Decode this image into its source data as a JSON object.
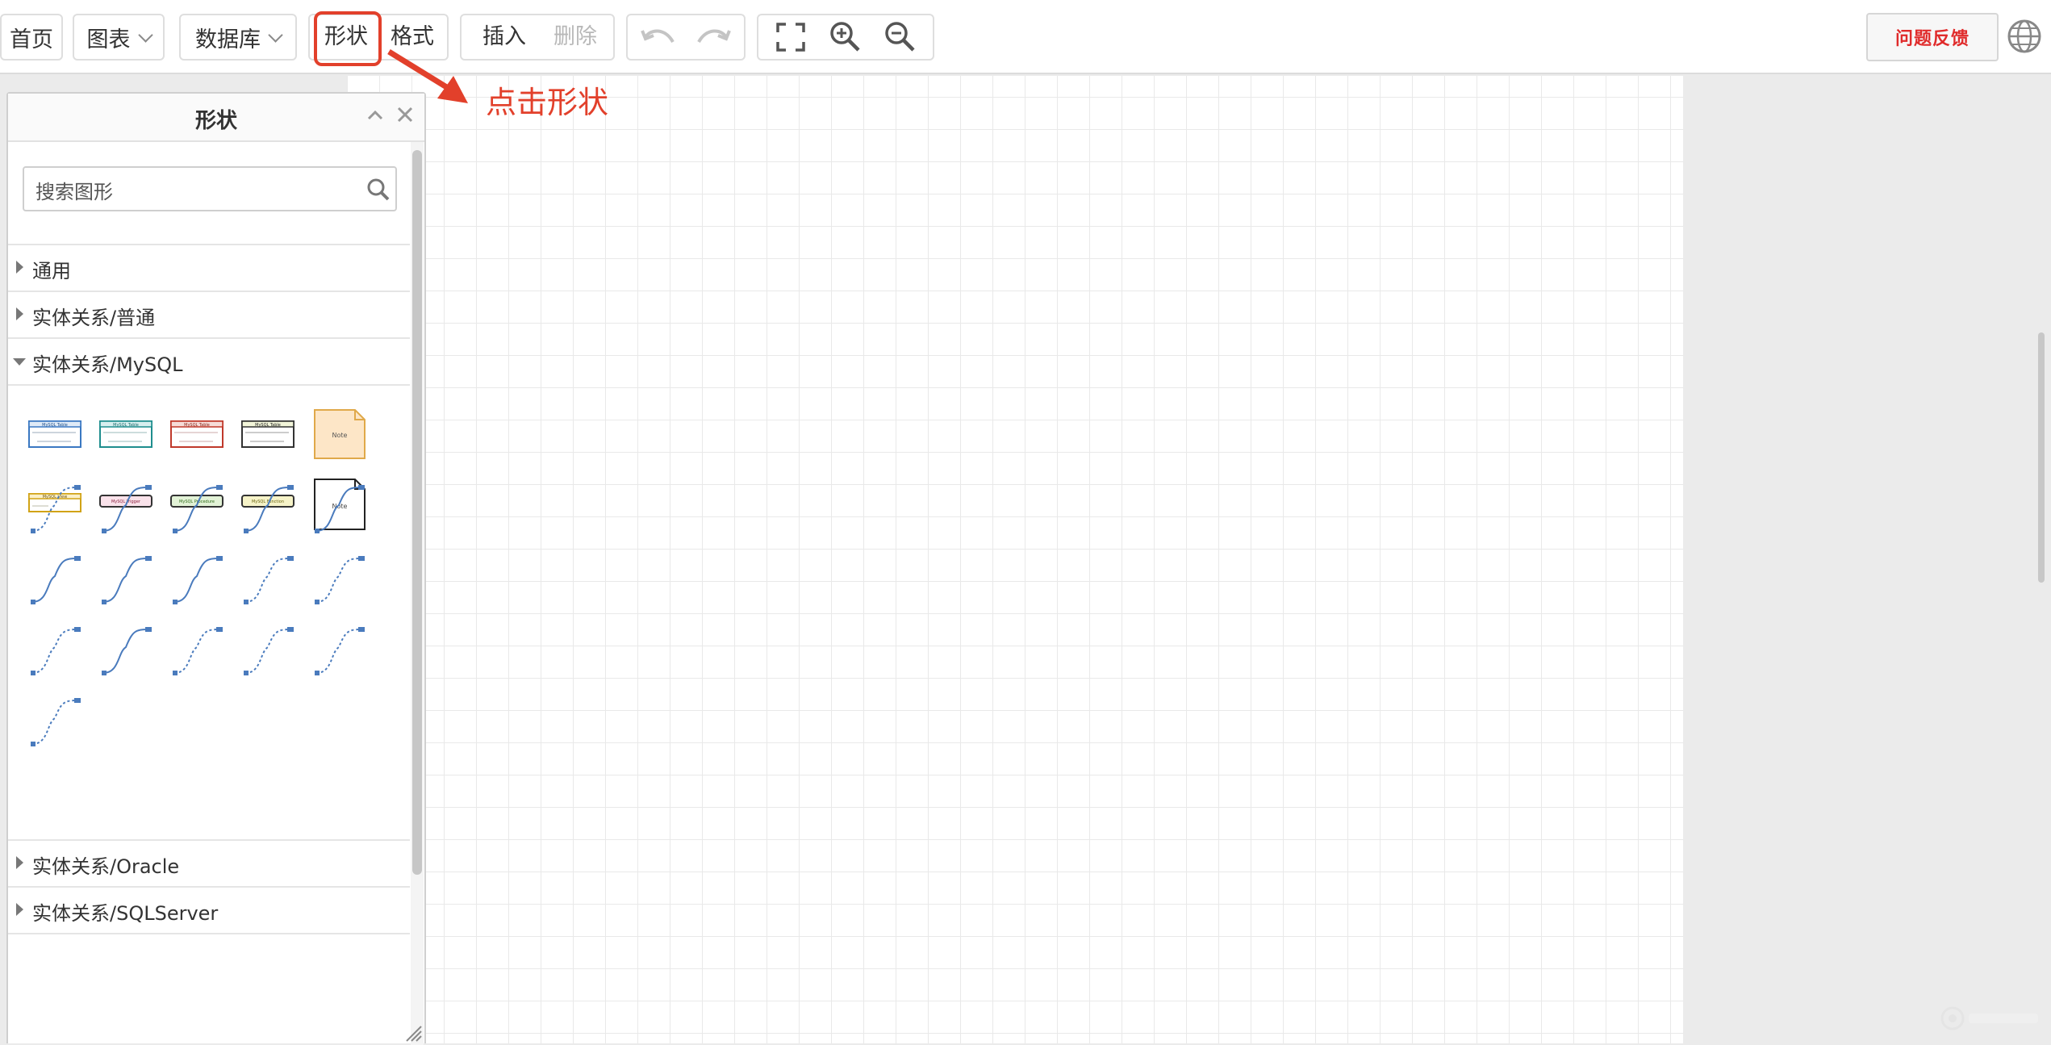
{
  "toolbar": {
    "home": "首页",
    "chart": "图表",
    "database": "数据库",
    "shape": "形状",
    "format": "格式",
    "insert": "插入",
    "delete": "删除",
    "feedback": "问题反馈"
  },
  "annotation": "点击形状",
  "panel": {
    "title": "形状",
    "search_placeholder": "搜索图形",
    "sections": [
      {
        "label": "通用",
        "expanded": false
      },
      {
        "label": "实体关系/普通",
        "expanded": false
      },
      {
        "label": "实体关系/MySQL",
        "expanded": true
      },
      {
        "label": "实体关系/Oracle",
        "expanded": false
      },
      {
        "label": "实体关系/SQLServer",
        "expanded": false
      }
    ],
    "table_label": "MySQL Table",
    "view_label": "MySQL View",
    "trigger_label": "MySQL Trigger",
    "procedure_label": "MySQL Procedure",
    "function_label": "MySQL Function",
    "note_label": "Note"
  },
  "colors": {
    "accent": "#e2402b",
    "feedback_text": "#e02b2b",
    "table_blue": "#3a78c2",
    "table_teal": "#1f8e8e",
    "table_red": "#c0392b",
    "table_dark": "#333333",
    "note_fill": "#fde6c7",
    "note_border": "#e0a94a"
  }
}
